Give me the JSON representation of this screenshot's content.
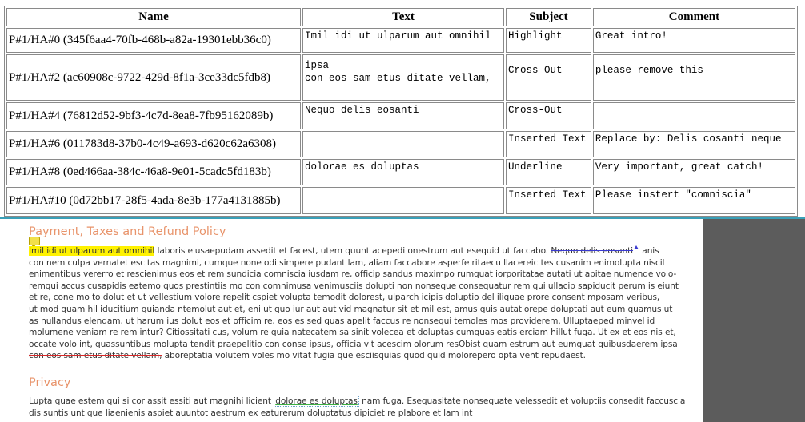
{
  "table": {
    "headers": [
      "Name",
      "Text",
      "Subject",
      "Comment"
    ],
    "rows": [
      {
        "name": "P#1/HA#0 (345f6aa4-70fb-468b-a82a-19301ebb36c0)",
        "text": "Imil idi ut ulparum aut omnihil",
        "subject": "Highlight",
        "comment": "Great intro!"
      },
      {
        "name": "P#1/HA#2 (ac60908c-9722-429d-8f1a-3ce33dc5fdb8)",
        "text": "ipsa\ncon eos sam etus ditate vellam,",
        "subject": "Cross-Out",
        "comment": "please remove this"
      },
      {
        "name": "P#1/HA#4 (76812d52-9bf3-4c7d-8ea8-7fb95162089b)",
        "text": "Nequo delis eosanti",
        "subject": "Cross-Out",
        "comment": ""
      },
      {
        "name": "P#1/HA#6 (011783d8-37b0-4c49-a693-d620c62a6308)",
        "text": "",
        "subject": "Inserted Text",
        "comment": "Replace by: Delis cosanti neque"
      },
      {
        "name": "P#1/HA#8 (0ed466aa-384c-46a8-9e01-5cadc5fd183b)",
        "text": "dolorae es doluptas",
        "subject": "Underline",
        "comment": "Very important, great catch!"
      },
      {
        "name": "P#1/HA#10 (0d72bb17-28f5-4ada-8e3b-177a4131885b)",
        "text": "",
        "subject": "Inserted Text",
        "comment": "Please instert \"comniscia\""
      }
    ]
  },
  "document": {
    "section1_title": "Payment, Taxes and Refund Policy",
    "p1": {
      "l1_highlight": "Imil idi ut ulparum aut omnihil",
      "l1_a": " laboris eiusaepudam assedit et facest, utem quunt acepedi onestrum aut esequid ut faccabo. ",
      "l1_strike": "Nequo delis eosanti",
      "l1_b": " anis",
      "l2": "con nem culpa vernatet escitas magnimi, cumque none odi simpere pudant lam, aliam faccabore asperfe ritaecu llacereic tes cusanim enimolupta niscil",
      "l3": "enimentibus vererro et rescienimus eos et rem sundicia comniscia iusdam re, officip sandus maximpo rumquat iorporitatae autati ut apitae numende volo-",
      "l4": "remqui accus cusapidis eatemo quos prestintiis mo con comnimusa venimusciis dolupti non nonseque consequatur rem qui ullacip sapiducit perum is eiunt",
      "l5": "et re, cone mo to dolut et ut vellestium volore repelit cspiet volupta temodit dolorest, ulparch icipis doluptio del iliquae prore consent mposam veribus,",
      "l6": "ut mod quam hil iducitium quianda ntemolut aut et, eni ut quo iur aut aut vid magnatur sit et mil est, amus quis autatiorepe doluptati aut eum quamus ut",
      "l7": "as nullandus elendam, ut harum ius dolut eos et officim re, eos es sed quas apelit faccus re nonsequi temoles mos providerem. Ulluptaeped minvel id",
      "l8": "molumene veniam re rem intur? Citiossitati cus, volum re quia natecatem sa sinit volecea et doluptas cumquas eatis erciam hillut fuga. Ut ex et eos nis et,",
      "l9_a": "occate volo int, quassuntibus molupta tendit praepelitio con conse ipsus, officia vit acescim olorum resObist quam estrum aut eumquat quibusdaerem ",
      "l9_strike": "ipsa",
      "l10_strike": "con eos sam etus ditate vellam,",
      "l10_b": " aboreptatia volutem voles mo vitat fugia que esciisquias quod quid molorepero opta vent repudaest."
    },
    "section2_title": "Privacy",
    "p2": {
      "l1_a": "Lupta quae estem qui si cor assit essiti aut magnihi licient ",
      "l1_underline": "dolorae es doluptas",
      "l1_b": " nam fuga. Esequasitate nonsequate velessedit et voluptiis consedit faccuscia",
      "l2": "dis suntis unt que liaenienis aspiet auuntot aestrum ex eaturerum doluptatus dipiciet re plabore et lam int"
    }
  },
  "colors": {
    "heading": "#e8936a",
    "highlight": "#fff200",
    "divider": "#3aa0b8",
    "sidebar": "#5c5c5c"
  }
}
